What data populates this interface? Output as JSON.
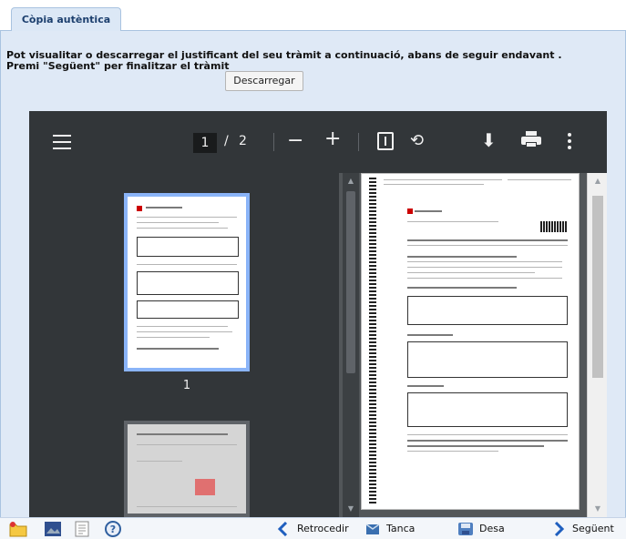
{
  "tab": {
    "label": "Còpia autèntica"
  },
  "message": {
    "line1": "Pot visualitar o descarregar el justificant del seu tràmit a continuació, abans de seguir endavant .",
    "line2": "Premi \"Següent\" per finalitzar el tràmit"
  },
  "download_button": "Descarregar",
  "viewer": {
    "current_page": "1",
    "page_separator": "/",
    "total_pages": "2",
    "thumbnail_label": "1"
  },
  "footer": {
    "back": "Retrocedir",
    "close": "Tanca",
    "save": "Desa",
    "next": "Següent"
  }
}
